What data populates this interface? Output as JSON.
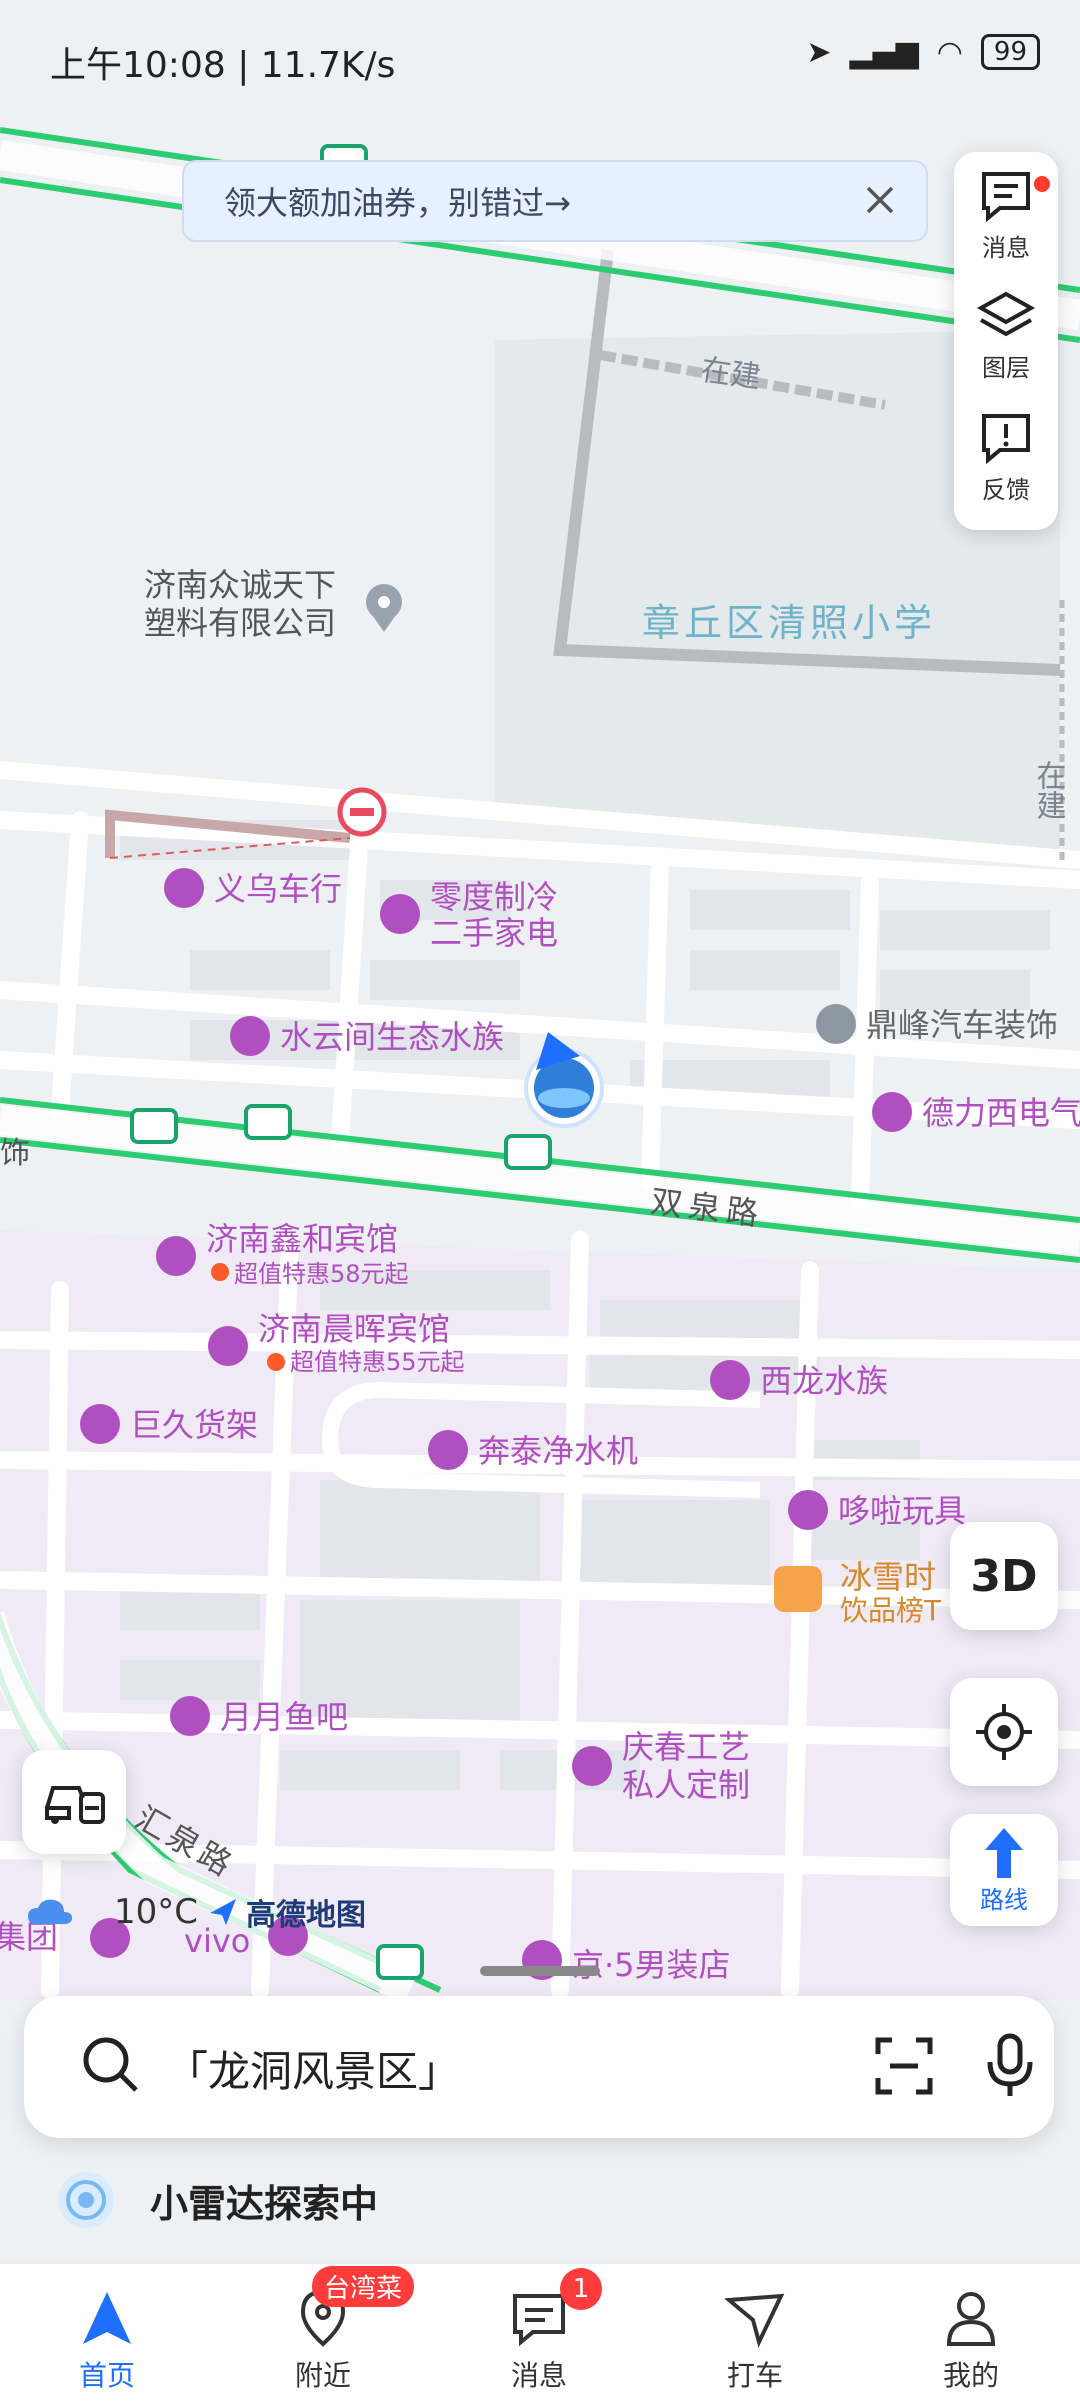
{
  "status_bar": {
    "time": "上午10:08 | 11.7K/s",
    "battery": "99"
  },
  "banner": {
    "text": "领大额加油券，别错过→"
  },
  "side_panel": {
    "messages_label": "消息",
    "layers_label": "图层",
    "feedback_label": "反馈"
  },
  "map_labels": {
    "construction_a": "在建",
    "construction_b": "在建",
    "company": "济南众诚天下塑料有限公司",
    "school": "章丘区清照小学",
    "road_shuangquan": "双泉路",
    "road_huiquan": "汇泉路",
    "left_edge": "饰"
  },
  "pois": [
    {
      "name": "义乌车行"
    },
    {
      "name": "零度制冷二手家电"
    },
    {
      "name": "水云间生态水族"
    },
    {
      "name": "鼎峰汽车装饰"
    },
    {
      "name": "德力西电气"
    },
    {
      "name": "济南鑫和宾馆",
      "promo": "超值特惠58元起"
    },
    {
      "name": "济南晨晖宾馆",
      "promo": "超值特惠55元起"
    },
    {
      "name": "西龙水族"
    },
    {
      "name": "巨久货架"
    },
    {
      "name": "奔泰净水机"
    },
    {
      "name": "哆啦玩具"
    },
    {
      "name": "冰雪时",
      "subtitle": "饮品榜T"
    },
    {
      "name": "月月鱼吧"
    },
    {
      "name": "庆春工艺私人定制"
    },
    {
      "name": "vivo"
    },
    {
      "name": "京·5男装店"
    },
    {
      "name": "集团"
    }
  ],
  "controls": {
    "btn_3d": "3D",
    "route_label": "路线"
  },
  "weather": {
    "temp": "10°C"
  },
  "logo": {
    "text": "高德地图"
  },
  "search": {
    "placeholder": "「龙洞风景区」"
  },
  "radar": {
    "text": "小雷达探索中"
  },
  "tabs": [
    {
      "label": "首页",
      "active": true
    },
    {
      "label": "附近",
      "tag": "台湾菜"
    },
    {
      "label": "消息",
      "badge": "1"
    },
    {
      "label": "打车"
    },
    {
      "label": "我的"
    }
  ],
  "colors": {
    "accent": "#1f6fff",
    "poi": "#b04fc0",
    "road_green": "#2ecc71",
    "badge_red": "#ff3b3b"
  }
}
